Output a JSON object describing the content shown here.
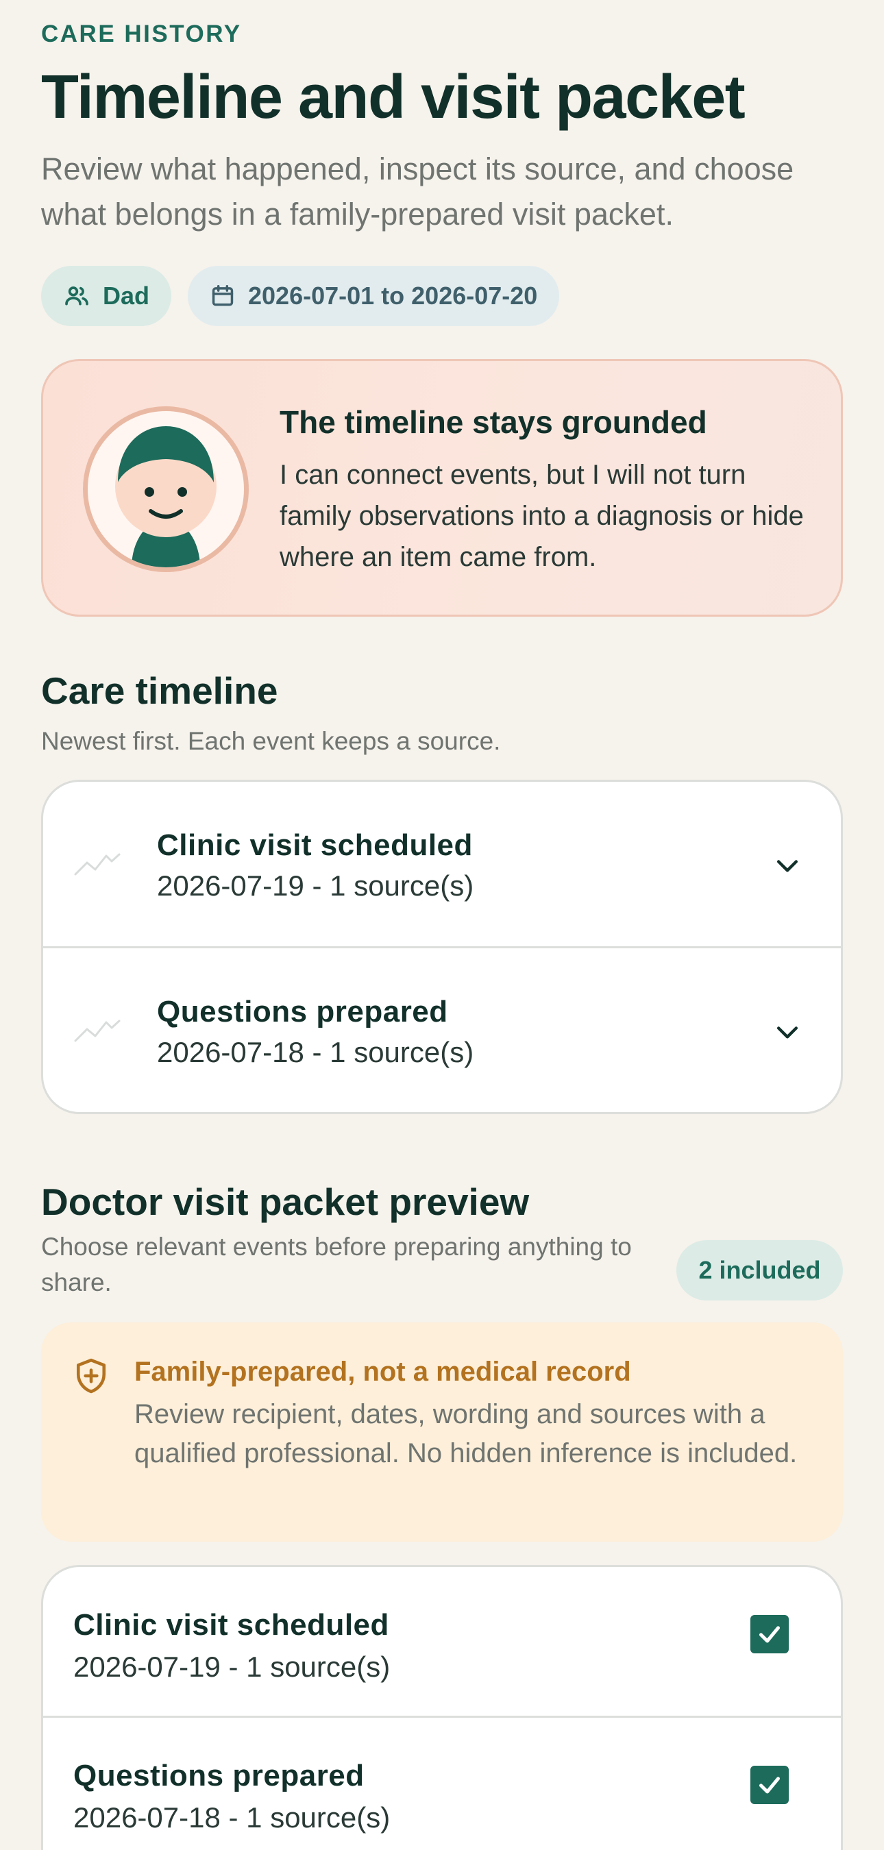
{
  "header": {
    "eyebrow": "CARE HISTORY",
    "title": "Timeline and visit packet",
    "subtitle": "Review what happened, inspect its source, and choose what belongs in a family-prepared visit packet."
  },
  "filters": {
    "person": {
      "label": "Dad",
      "icon": "people-icon"
    },
    "date_range": {
      "label": "2026-07-01 to 2026-07-20",
      "icon": "calendar-icon"
    }
  },
  "assistant_card": {
    "title": "The timeline stays grounded",
    "body": "I can connect events, but I will not turn family observations into a diagnosis or hide where an item came from."
  },
  "timeline": {
    "title": "Care timeline",
    "subtitle": "Newest first. Each event keeps a source.",
    "events": [
      {
        "title": "Clinic visit scheduled",
        "meta": "2026-07-19 - 1 source(s)",
        "icon": "activity-icon"
      },
      {
        "title": "Questions prepared",
        "meta": "2026-07-18 - 1 source(s)",
        "icon": "activity-icon"
      }
    ]
  },
  "packet": {
    "title": "Doctor visit packet preview",
    "subtitle": "Choose relevant events before preparing anything to share.",
    "count_badge": "2 included",
    "notice": {
      "title": "Family-prepared, not a medical record",
      "body": "Review recipient, dates, wording and sources with a qualified professional. No hidden inference is included.",
      "icon": "shield-plus-icon"
    },
    "items": [
      {
        "title": "Clinic visit scheduled",
        "meta": "2026-07-19 - 1 source(s)",
        "checked": true
      },
      {
        "title": "Questions prepared",
        "meta": "2026-07-18 - 1 source(s)",
        "checked": true
      }
    ]
  },
  "colors": {
    "accent": "#1d6b5b",
    "background": "#f6f2ec",
    "warning_text": "#b3721f",
    "warning_bg": "#fdefd9",
    "assistant_bg": "#fbe0d6"
  }
}
